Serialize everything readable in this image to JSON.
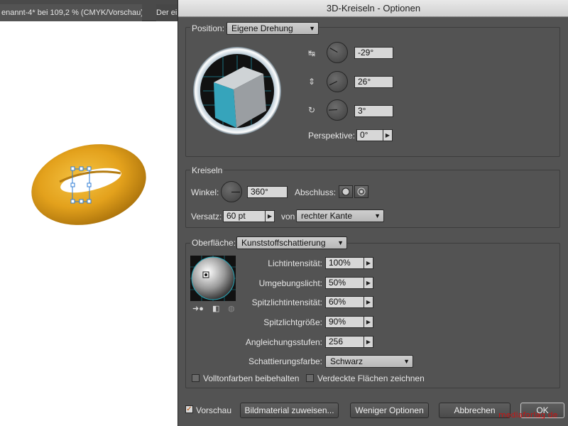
{
  "document": {
    "tab1_label": "enannt-4* bei 109,2 % (CMYK/Vorschau)",
    "tab1_close": "✕",
    "tab2_label": "Der ei"
  },
  "dialog": {
    "title": "3D-Kreiseln - Optionen",
    "position": {
      "label": "Position:",
      "preset": "Eigene Drehung",
      "x_rotation": "-29°",
      "y_rotation": "26°",
      "z_rotation": "3°",
      "perspective_label": "Perspektive:",
      "perspective_value": "0°"
    },
    "revolve": {
      "group_label": "Kreiseln",
      "angle_label": "Winkel:",
      "angle_value": "360°",
      "cap_label": "Abschluss:",
      "offset_label": "Versatz:",
      "offset_value": "60 pt",
      "from_label": "von",
      "from_value": "rechter Kante"
    },
    "surface": {
      "label": "Oberfläche:",
      "type": "Kunststoffschattierung",
      "light_intensity_label": "Lichtintensität:",
      "light_intensity_value": "100%",
      "ambient_label": "Umgebungslicht:",
      "ambient_value": "50%",
      "highlight_intensity_label": "Spitzlichtintensität:",
      "highlight_intensity_value": "60%",
      "highlight_size_label": "Spitzlichtgröße:",
      "highlight_size_value": "90%",
      "blend_steps_label": "Angleichungsstufen:",
      "blend_steps_value": "256",
      "shading_color_label": "Schattierungsfarbe:",
      "shading_color_value": "Schwarz",
      "preserve_spot_label": "Volltonfarben beibehalten",
      "hidden_faces_label": "Verdeckte Flächen zeichnen"
    },
    "footer": {
      "preview_label": "Vorschau",
      "map_art_label": "Bildmaterial zuweisen...",
      "fewer_options_label": "Weniger Optionen",
      "cancel_label": "Abbrechen",
      "ok_label": "OK"
    },
    "watermark": "mediaforlag de"
  },
  "colors": {
    "dialog_bg": "#535353",
    "cube_front": "#36a4bb",
    "torus_gold": "#e6a51f",
    "selection_blue": "#2f7dd6"
  }
}
